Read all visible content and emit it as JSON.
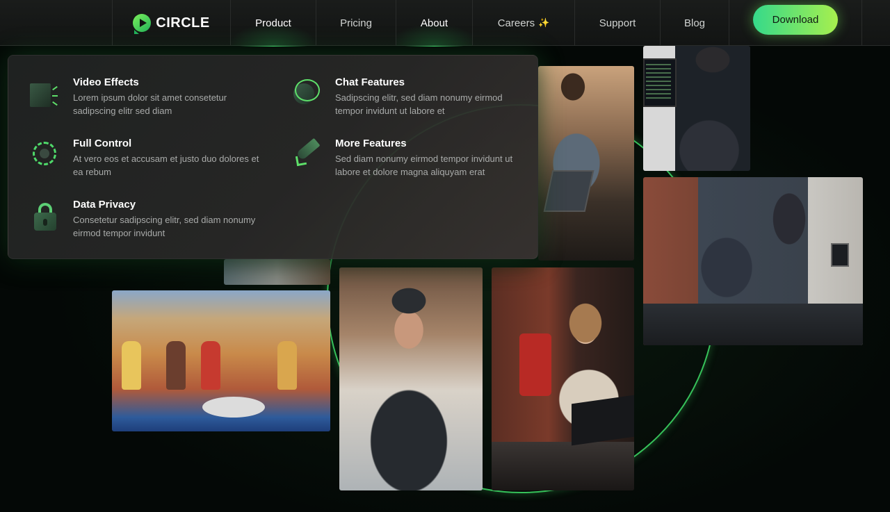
{
  "brand": {
    "name": "CIRCLE",
    "logo_icon": "play-circle-icon",
    "accent": "#3fd56a"
  },
  "nav": {
    "items": [
      {
        "label": "Product",
        "active": true
      },
      {
        "label": "Pricing",
        "active": false
      },
      {
        "label": "About",
        "active": true
      },
      {
        "label": "Careers",
        "badge_icon": "sparkle-icon",
        "badge": "✨",
        "active": false
      },
      {
        "label": "Support",
        "active": false
      },
      {
        "label": "Blog",
        "active": false
      }
    ],
    "download_label": "Download"
  },
  "dropdown": {
    "features": [
      {
        "title": "Video Effects",
        "desc": "Lorem ipsum dolor sit amet consetetur sadipscing elitr sed diam",
        "icon": "video-effects-icon"
      },
      {
        "title": "Chat Features",
        "desc": "Sadipscing elitr, sed diam nonumy eirmod tempor invidunt ut labore et",
        "icon": "chat-icon"
      },
      {
        "title": "Full Control",
        "desc": "At vero eos et accusam et justo duo dolores et ea rebum",
        "icon": "gear-icon"
      },
      {
        "title": "More Features",
        "desc": "Sed diam nonumy eirmod tempor invidunt ut labore et dolore magna aliquyam erat",
        "icon": "rocket-icon"
      },
      {
        "title": "Data Privacy",
        "desc": "Consetetur sadipscing elitr, sed diam nonumy eirmod tempor invidunt",
        "icon": "lock-icon"
      }
    ]
  }
}
